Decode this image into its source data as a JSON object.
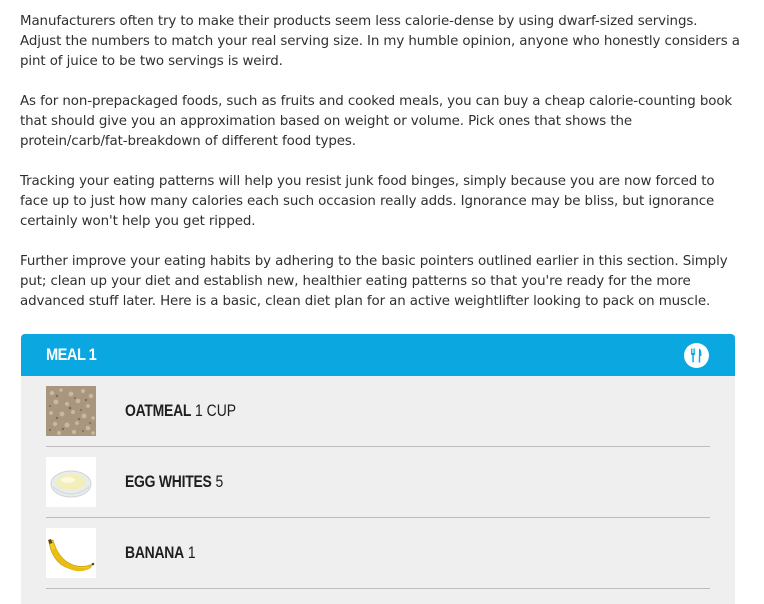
{
  "paragraphs": [
    "Manufacturers often try to make their products seem less calorie-dense by using dwarf-sized servings. Adjust the numbers to match your real serving size. In my humble opinion, anyone who honestly considers a pint of juice to be two servings is weird.",
    "As for non-prepackaged foods, such as fruits and cooked meals, you can buy a cheap calorie-counting book that should give you an approximation based on weight or volume. Pick ones that shows the protein/carb/fat-breakdown of different food types.",
    "Tracking your eating patterns will help you resist junk food binges, simply because you are now forced to face up to just how many calories each such occasion really adds. Ignorance may be bliss, but ignorance certainly won't help you get ripped.",
    "Further improve your eating habits by adhering to the basic pointers outlined earlier in this section. Simply put; clean up your diet and establish new, healthier eating patterns so that you're ready for the more advanced stuff later. Here is a basic, clean diet plan for an active weightlifter looking to pack on muscle."
  ],
  "meal": {
    "title": "MEAL 1",
    "icon": "utensils-icon",
    "accent_color": "#0ba7e1",
    "items": [
      {
        "name": "OATMEAL",
        "qty": "1 CUP",
        "image": "oatmeal-image"
      },
      {
        "name": "EGG WHITES",
        "qty": "5",
        "image": "egg-whites-image"
      },
      {
        "name": "BANANA",
        "qty": "1",
        "image": "banana-image"
      }
    ]
  }
}
